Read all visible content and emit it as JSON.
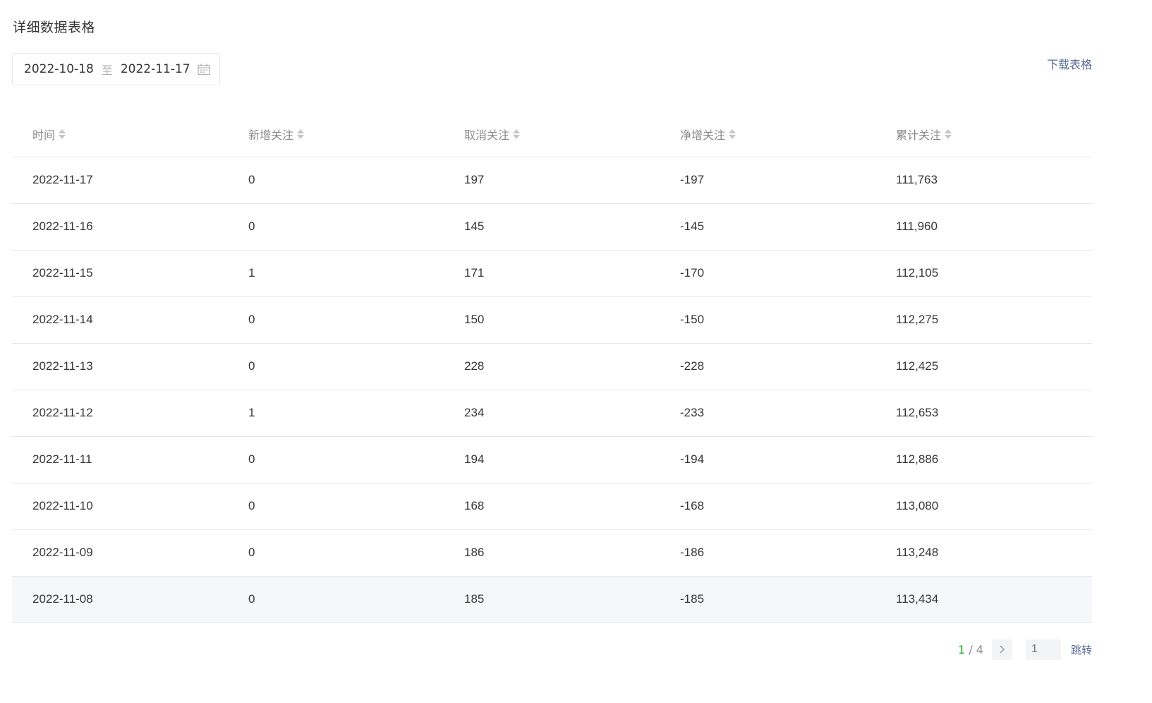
{
  "title": "详细数据表格",
  "date_range": {
    "start": "2022-10-18",
    "separator": "至",
    "end": "2022-11-17"
  },
  "download_label": "下载表格",
  "table": {
    "columns": [
      "时间",
      "新增关注",
      "取消关注",
      "净增关注",
      "累计关注"
    ],
    "rows": [
      [
        "2022-11-17",
        "0",
        "197",
        "-197",
        "111,763"
      ],
      [
        "2022-11-16",
        "0",
        "145",
        "-145",
        "111,960"
      ],
      [
        "2022-11-15",
        "1",
        "171",
        "-170",
        "112,105"
      ],
      [
        "2022-11-14",
        "0",
        "150",
        "-150",
        "112,275"
      ],
      [
        "2022-11-13",
        "0",
        "228",
        "-228",
        "112,425"
      ],
      [
        "2022-11-12",
        "1",
        "234",
        "-233",
        "112,653"
      ],
      [
        "2022-11-11",
        "0",
        "194",
        "-194",
        "112,886"
      ],
      [
        "2022-11-10",
        "0",
        "168",
        "-168",
        "113,080"
      ],
      [
        "2022-11-09",
        "0",
        "186",
        "-186",
        "113,248"
      ],
      [
        "2022-11-08",
        "0",
        "185",
        "-185",
        "113,434"
      ]
    ]
  },
  "pagination": {
    "current": "1",
    "separator": " / ",
    "total": "4",
    "input_placeholder": "1",
    "jump_label": "跳转"
  },
  "icons": {
    "calendar": "calendar-icon",
    "sort": "sort-icon",
    "next": "chevron-right-icon"
  },
  "colors": {
    "link": "#576b95",
    "current_page": "#1aad19",
    "hover_row": "#f6f7f9"
  }
}
